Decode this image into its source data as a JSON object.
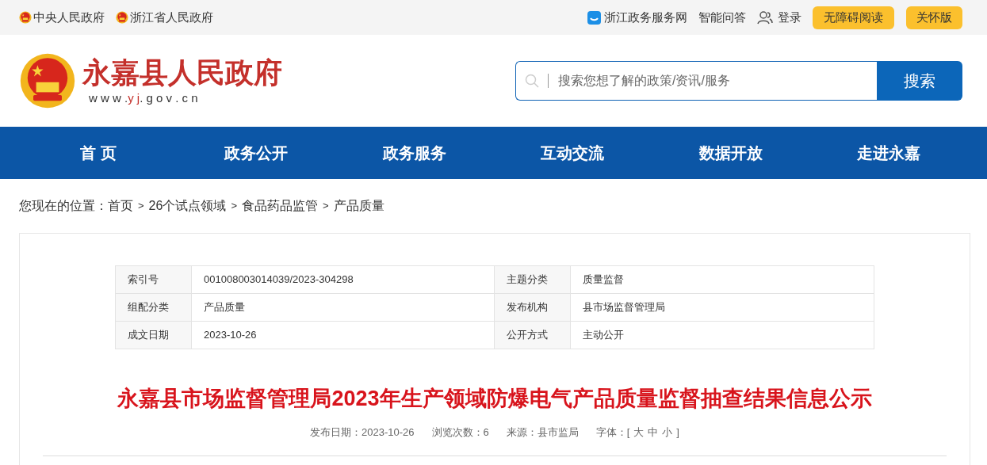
{
  "top_bar": {
    "left_links": [
      "中央人民政府",
      "浙江省人民政府"
    ],
    "service_link": "浙江政务服务网",
    "qa_link": "智能问答",
    "login": "登录",
    "buttons": [
      "无障碍阅读",
      "关怀版"
    ]
  },
  "header": {
    "site_title": "永嘉县人民政府",
    "domain_prefix": "w w w .",
    "domain_highlight": "y j",
    "domain_suffix": ". g o v . c n",
    "search": {
      "placeholder": "搜索您想了解的政策/资讯/服务",
      "button": "搜索"
    }
  },
  "nav": [
    "首 页",
    "政务公开",
    "政务服务",
    "互动交流",
    "数据开放",
    "走进永嘉"
  ],
  "breadcrumb": {
    "label": "您现在的位置：",
    "items": [
      "首页",
      "26个试点领域",
      "食品药品监管",
      "产品质量"
    ],
    "separator": ">"
  },
  "info_table": [
    {
      "label_1": "索引号",
      "value_1": "001008003014039/2023-304298",
      "label_2": "主题分类",
      "value_2": "质量监督"
    },
    {
      "label_1": "组配分类",
      "value_1": "产品质量",
      "label_2": "发布机构",
      "value_2": "县市场监督管理局"
    },
    {
      "label_1": "成文日期",
      "value_1": "2023-10-26",
      "label_2": "公开方式",
      "value_2": "主动公开"
    }
  ],
  "article": {
    "title": "永嘉县市场监督管理局2023年生产领域防爆电气产品质量监督抽查结果信息公示",
    "meta": [
      "发布日期：2023-10-26",
      "浏览次数：6",
      "来源：县市监局"
    ],
    "font_label": "字体：[",
    "font_sizes": [
      "大",
      "中",
      "小"
    ],
    "font_close": "]"
  }
}
